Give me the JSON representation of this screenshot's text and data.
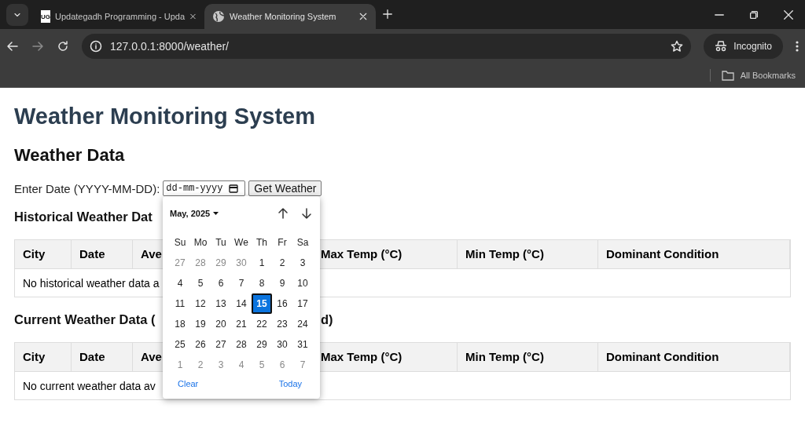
{
  "browser": {
    "tabs": [
      {
        "title": "Updategadh Programming - Upda",
        "selected": false,
        "kind": "logo",
        "logo": "UG"
      },
      {
        "title": "Weather Monitoring System",
        "selected": true,
        "kind": "globe"
      }
    ],
    "url": "127.0.0.1:8000/weather/",
    "profile": "Incognito",
    "bookmarks": "All Bookmarks"
  },
  "page": {
    "title": "Weather Monitoring System",
    "section": "Weather Data",
    "date_label": "Enter Date (YYYY-MM-DD):",
    "date_field": {
      "placeholder": "dd-mm-yyyy"
    },
    "button": "Get Weather",
    "tables": [
      {
        "heading_parts": [
          "Historical Weather Dat"
        ],
        "columns": [
          "City",
          "Date",
          "Ave",
          "Max Temp (°C)",
          "Min Temp (°C)",
          "Dominant Condition"
        ],
        "empty_message": "No historical weather data a"
      },
      {
        "heading_parts": [
          "Current Weather Data (",
          "d)"
        ],
        "columns": [
          "City",
          "Date",
          "Ave",
          "Max Temp (°C)",
          "Min Temp (°C)",
          "Dominant Condition"
        ],
        "empty_message": "No current weather data av"
      }
    ]
  },
  "date_picker": {
    "month": "May, 2025",
    "weekdays": [
      "Su",
      "Mo",
      "Tu",
      "We",
      "Th",
      "Fr",
      "Sa"
    ],
    "days": [
      {
        "label": "27",
        "muted": true,
        "selected": false
      },
      {
        "label": "28",
        "muted": true,
        "selected": false
      },
      {
        "label": "29",
        "muted": true,
        "selected": false
      },
      {
        "label": "30",
        "muted": true,
        "selected": false
      },
      {
        "label": "1",
        "muted": false,
        "selected": false
      },
      {
        "label": "2",
        "muted": false,
        "selected": false
      },
      {
        "label": "3",
        "muted": false,
        "selected": false
      },
      {
        "label": "4",
        "muted": false,
        "selected": false
      },
      {
        "label": "5",
        "muted": false,
        "selected": false
      },
      {
        "label": "6",
        "muted": false,
        "selected": false
      },
      {
        "label": "7",
        "muted": false,
        "selected": false
      },
      {
        "label": "8",
        "muted": false,
        "selected": false
      },
      {
        "label": "9",
        "muted": false,
        "selected": false
      },
      {
        "label": "10",
        "muted": false,
        "selected": false
      },
      {
        "label": "11",
        "muted": false,
        "selected": false
      },
      {
        "label": "12",
        "muted": false,
        "selected": false
      },
      {
        "label": "13",
        "muted": false,
        "selected": false
      },
      {
        "label": "14",
        "muted": false,
        "selected": false
      },
      {
        "label": "15",
        "muted": false,
        "selected": true
      },
      {
        "label": "16",
        "muted": false,
        "selected": false
      },
      {
        "label": "17",
        "muted": false,
        "selected": false
      },
      {
        "label": "18",
        "muted": false,
        "selected": false
      },
      {
        "label": "19",
        "muted": false,
        "selected": false
      },
      {
        "label": "20",
        "muted": false,
        "selected": false
      },
      {
        "label": "21",
        "muted": false,
        "selected": false
      },
      {
        "label": "22",
        "muted": false,
        "selected": false
      },
      {
        "label": "23",
        "muted": false,
        "selected": false
      },
      {
        "label": "24",
        "muted": false,
        "selected": false
      },
      {
        "label": "25",
        "muted": false,
        "selected": false
      },
      {
        "label": "26",
        "muted": false,
        "selected": false
      },
      {
        "label": "27",
        "muted": false,
        "selected": false
      },
      {
        "label": "28",
        "muted": false,
        "selected": false
      },
      {
        "label": "29",
        "muted": false,
        "selected": false
      },
      {
        "label": "30",
        "muted": false,
        "selected": false
      },
      {
        "label": "31",
        "muted": false,
        "selected": false
      },
      {
        "label": "1",
        "muted": true,
        "selected": false
      },
      {
        "label": "2",
        "muted": true,
        "selected": false
      },
      {
        "label": "3",
        "muted": true,
        "selected": false
      },
      {
        "label": "4",
        "muted": true,
        "selected": false
      },
      {
        "label": "5",
        "muted": true,
        "selected": false
      },
      {
        "label": "6",
        "muted": true,
        "selected": false
      },
      {
        "label": "7",
        "muted": true,
        "selected": false
      }
    ],
    "clear": "Clear",
    "today": "Today"
  }
}
